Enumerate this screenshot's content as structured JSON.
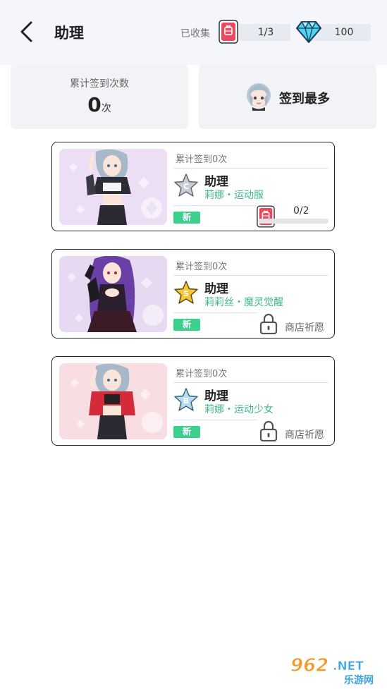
{
  "header": {
    "title": "助理",
    "collected_label": "已收集",
    "collected_value": "1/3",
    "diamond_value": "100"
  },
  "summary": {
    "signin_label": "累计签到次数",
    "signin_count": "0",
    "signin_unit": "次",
    "most_label": "签到最多"
  },
  "cards": [
    {
      "count_label": "累计签到0次",
      "rank": "C",
      "title": "助理",
      "subtitle": "莉娜・运动服",
      "badge": "新",
      "unlock": {
        "type": "progress",
        "text": "0/2",
        "fraction": 0
      },
      "colors": {
        "bg": "#ecdff5",
        "star": "#c9ced6"
      }
    },
    {
      "count_label": "累计签到0次",
      "rank": "S",
      "title": "助理",
      "subtitle": "莉莉丝・魔灵觉醒",
      "badge": "新",
      "unlock": {
        "type": "locked",
        "text": "商店祈愿"
      },
      "colors": {
        "bg": "#e8d9f3",
        "star": "#f7c533"
      }
    },
    {
      "count_label": "累计签到0次",
      "rank": "B",
      "title": "助理",
      "subtitle": "莉娜・运动少女",
      "badge": "新",
      "unlock": {
        "type": "locked",
        "text": "商店祈愿"
      },
      "colors": {
        "bg": "#f8dde2",
        "star": "#b6dcf3"
      }
    }
  ],
  "watermark": {
    "top": "962.NET",
    "bottom": "乐游网"
  },
  "colors": {
    "accent_green": "#3fb78d",
    "badge_green": "#3ccf8e",
    "bag_red": "#e84a5f"
  }
}
